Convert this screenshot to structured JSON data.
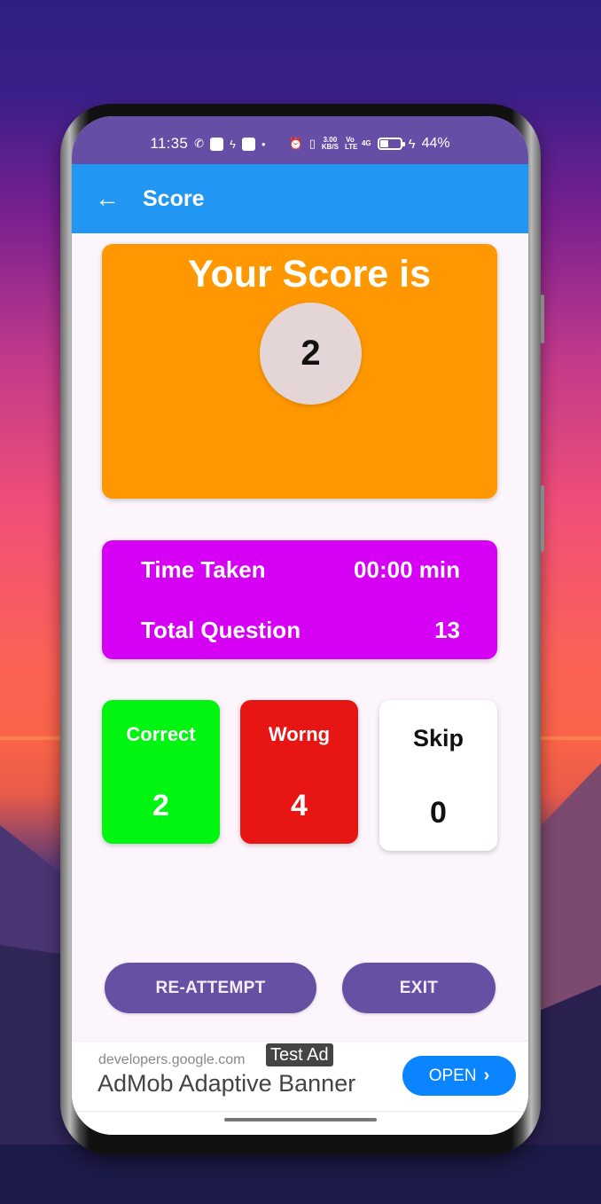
{
  "status_bar": {
    "time": "11:35",
    "icons": [
      "whatsapp-icon",
      "screen-recorder-icon",
      "bolt-icon",
      "app-notification-icon",
      "dot-icon",
      "alarm-icon",
      "vibrate-icon",
      "network-speed-icon",
      "volte-icon",
      "signal-4g-icon",
      "battery-icon",
      "charging-icon"
    ],
    "net_speed_value": "3.00",
    "net_speed_unit": "KB/S",
    "volte": "Vo LTE",
    "network_type": "4G",
    "battery_percent": "44%"
  },
  "app_bar": {
    "title": "Score",
    "back_icon": "arrow-left-icon"
  },
  "score_card": {
    "heading": "Your Score is",
    "score": "2",
    "color": "#ff9800"
  },
  "info_card": {
    "time_label": "Time Taken",
    "time_value": "00:00 min",
    "total_label": "Total Question",
    "total_value": "13",
    "color": "#d500f4"
  },
  "stats": {
    "correct": {
      "label": "Correct",
      "value": "2",
      "color": "#00f511"
    },
    "wrong": {
      "label": "Worng",
      "value": "4",
      "color": "#e81515"
    },
    "skip": {
      "label": "Skip",
      "value": "0",
      "color": "#ffffff"
    }
  },
  "actions": {
    "reattempt_label": "RE-ATTEMPT",
    "exit_label": "EXIT",
    "color": "#6750a4"
  },
  "ad": {
    "domain": "developers.google.com",
    "badge": "Test Ad",
    "title": "AdMob Adaptive Banner",
    "cta": "OPEN",
    "cta_icon": "chevron-right-icon",
    "cta_color": "#0a84ff"
  }
}
